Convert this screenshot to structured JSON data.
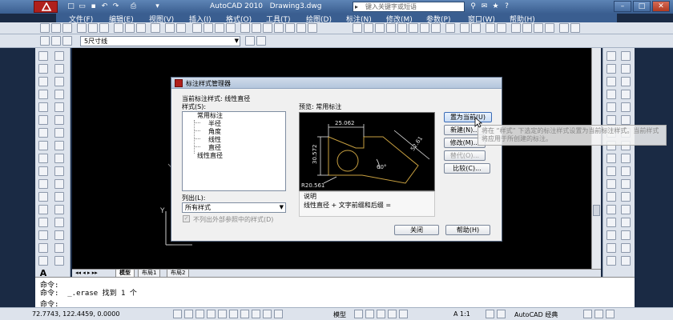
{
  "app": {
    "title": "AutoCAD 2010",
    "filename": "Drawing3.dwg",
    "search_placeholder": "键入关键字或短语"
  },
  "menu": [
    "文件(F)",
    "编辑(E)",
    "视图(V)",
    "插入(I)",
    "格式(O)",
    "工具(T)",
    "绘图(D)",
    "标注(N)",
    "修改(M)",
    "参数(P)",
    "窗口(W)",
    "帮助(H)"
  ],
  "toolbar": {
    "dim_style": "5尺寸线"
  },
  "tabs": [
    "模型",
    "布局1",
    "布局2"
  ],
  "command": {
    "lines": [
      "命令:",
      "命令:  _.erase 找到 1 个",
      "命令:"
    ]
  },
  "status": {
    "coords": "72.7743,  122.4459,  0.0000",
    "model": "模型",
    "scale": "A 1:1",
    "workspace": "AutoCAD 经典"
  },
  "dialog": {
    "title": "标注样式管理器",
    "current_label": "当前标注样式: 线性直径",
    "styles_label": "样式(S):",
    "styles": [
      "常用标注",
      "半径",
      "角度",
      "线性",
      "直径",
      "线性直径"
    ],
    "preview_label": "预览: 常用标注",
    "list_label": "列出(L):",
    "list_value": "所有样式",
    "xref_label": "不列出外部参照中的样式(D)",
    "desc_label": "说明",
    "desc_text": "线性直径 + 文字前缀和后缀 =",
    "buttons": {
      "set_current": "置为当前(U)",
      "new": "新建(N)...",
      "modify": "修改(M)...",
      "override": "替代(O)...",
      "compare": "比较(C)...",
      "close": "关闭",
      "help": "帮助(H)"
    },
    "preview": {
      "dim_top": "25.062",
      "dim_left": "30.572",
      "dim_diag": "52.61",
      "angle": "60°",
      "radius": "R20.561"
    }
  },
  "tooltip": {
    "text": "将在 “样式” 下选定的标注样式设置为当前标注样式。当前样式将应用于所创建的标注。"
  },
  "colors": {
    "drawing_bg": "#000000",
    "preview_geometry": "#c8a040",
    "accent": "#b0201c"
  }
}
